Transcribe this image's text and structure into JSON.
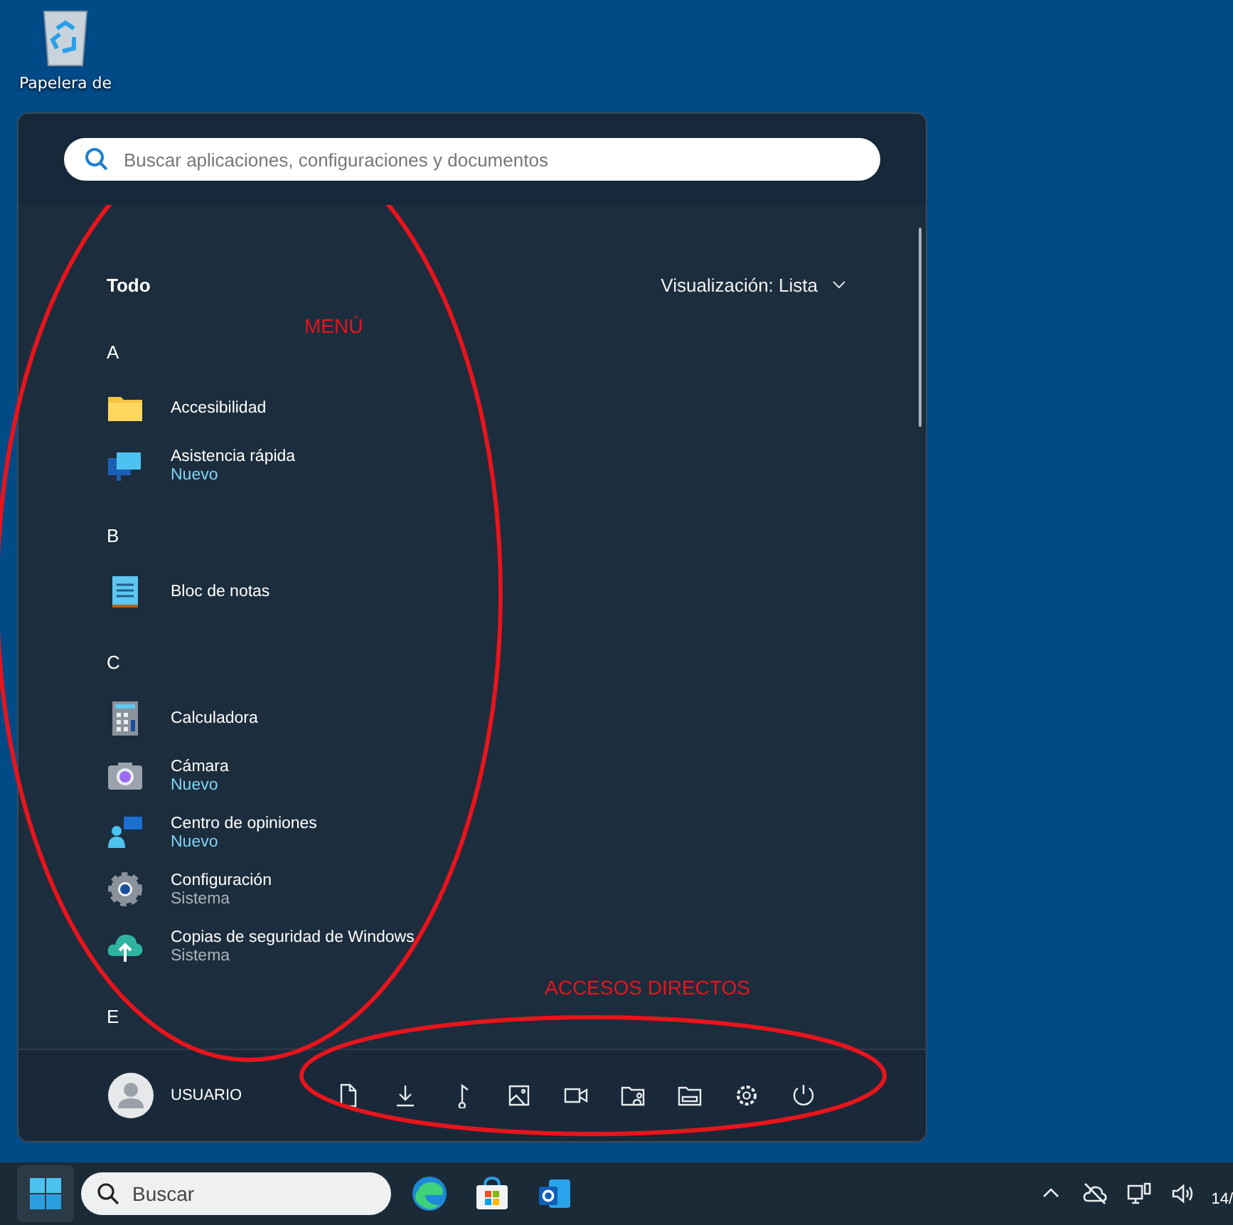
{
  "desktop": {
    "icons": [
      {
        "label": "Papelera de",
        "kind": "recycle-bin"
      }
    ]
  },
  "start_menu": {
    "search": {
      "placeholder": "Buscar aplicaciones, configuraciones y documentos"
    },
    "section_title": "Todo",
    "view_toggle": "Visualización: Lista",
    "groups": [
      {
        "letter": "A",
        "apps": [
          {
            "name": "Accesibilidad",
            "kind": "folder"
          },
          {
            "name": "Asistencia rápida",
            "subtitle": "Nuevo",
            "highlight": true,
            "kind": "monitor"
          }
        ]
      },
      {
        "letter": "B",
        "apps": [
          {
            "name": "Bloc de notas",
            "kind": "notepad"
          }
        ]
      },
      {
        "letter": "C",
        "apps": [
          {
            "name": "Calculadora",
            "kind": "calculator"
          },
          {
            "name": "Cámara",
            "subtitle": "Nuevo",
            "highlight": true,
            "kind": "camera"
          },
          {
            "name": "Centro de opiniones",
            "subtitle": "Nuevo",
            "highlight": true,
            "kind": "feedback"
          },
          {
            "name": "Configuración",
            "subtitle": "Sistema",
            "highlight": false,
            "kind": "gear"
          },
          {
            "name": "Copias de seguridad de Windows",
            "subtitle": "Sistema",
            "highlight": false,
            "kind": "cloud"
          }
        ]
      },
      {
        "letter": "E"
      }
    ],
    "user": {
      "name": "USUARIO"
    },
    "shortcuts": [
      {
        "kind": "document"
      },
      {
        "kind": "download"
      },
      {
        "kind": "music"
      },
      {
        "kind": "picture"
      },
      {
        "kind": "video"
      },
      {
        "kind": "folder-user"
      },
      {
        "kind": "drive"
      },
      {
        "kind": "settings"
      },
      {
        "kind": "power"
      }
    ]
  },
  "taskbar": {
    "search": {
      "placeholder": "Buscar"
    },
    "apps": [
      {
        "kind": "edge"
      },
      {
        "kind": "store"
      },
      {
        "kind": "outlook"
      }
    ],
    "tray": [
      {
        "kind": "chevron"
      },
      {
        "kind": "cloud-off"
      },
      {
        "kind": "network"
      },
      {
        "kind": "volume"
      }
    ],
    "clock": "14/"
  },
  "annotations": [
    {
      "text": "MENÚ",
      "color": "#e8141c"
    },
    {
      "text": "ACCESOS DIRECTOS",
      "color": "#e8141c"
    }
  ]
}
